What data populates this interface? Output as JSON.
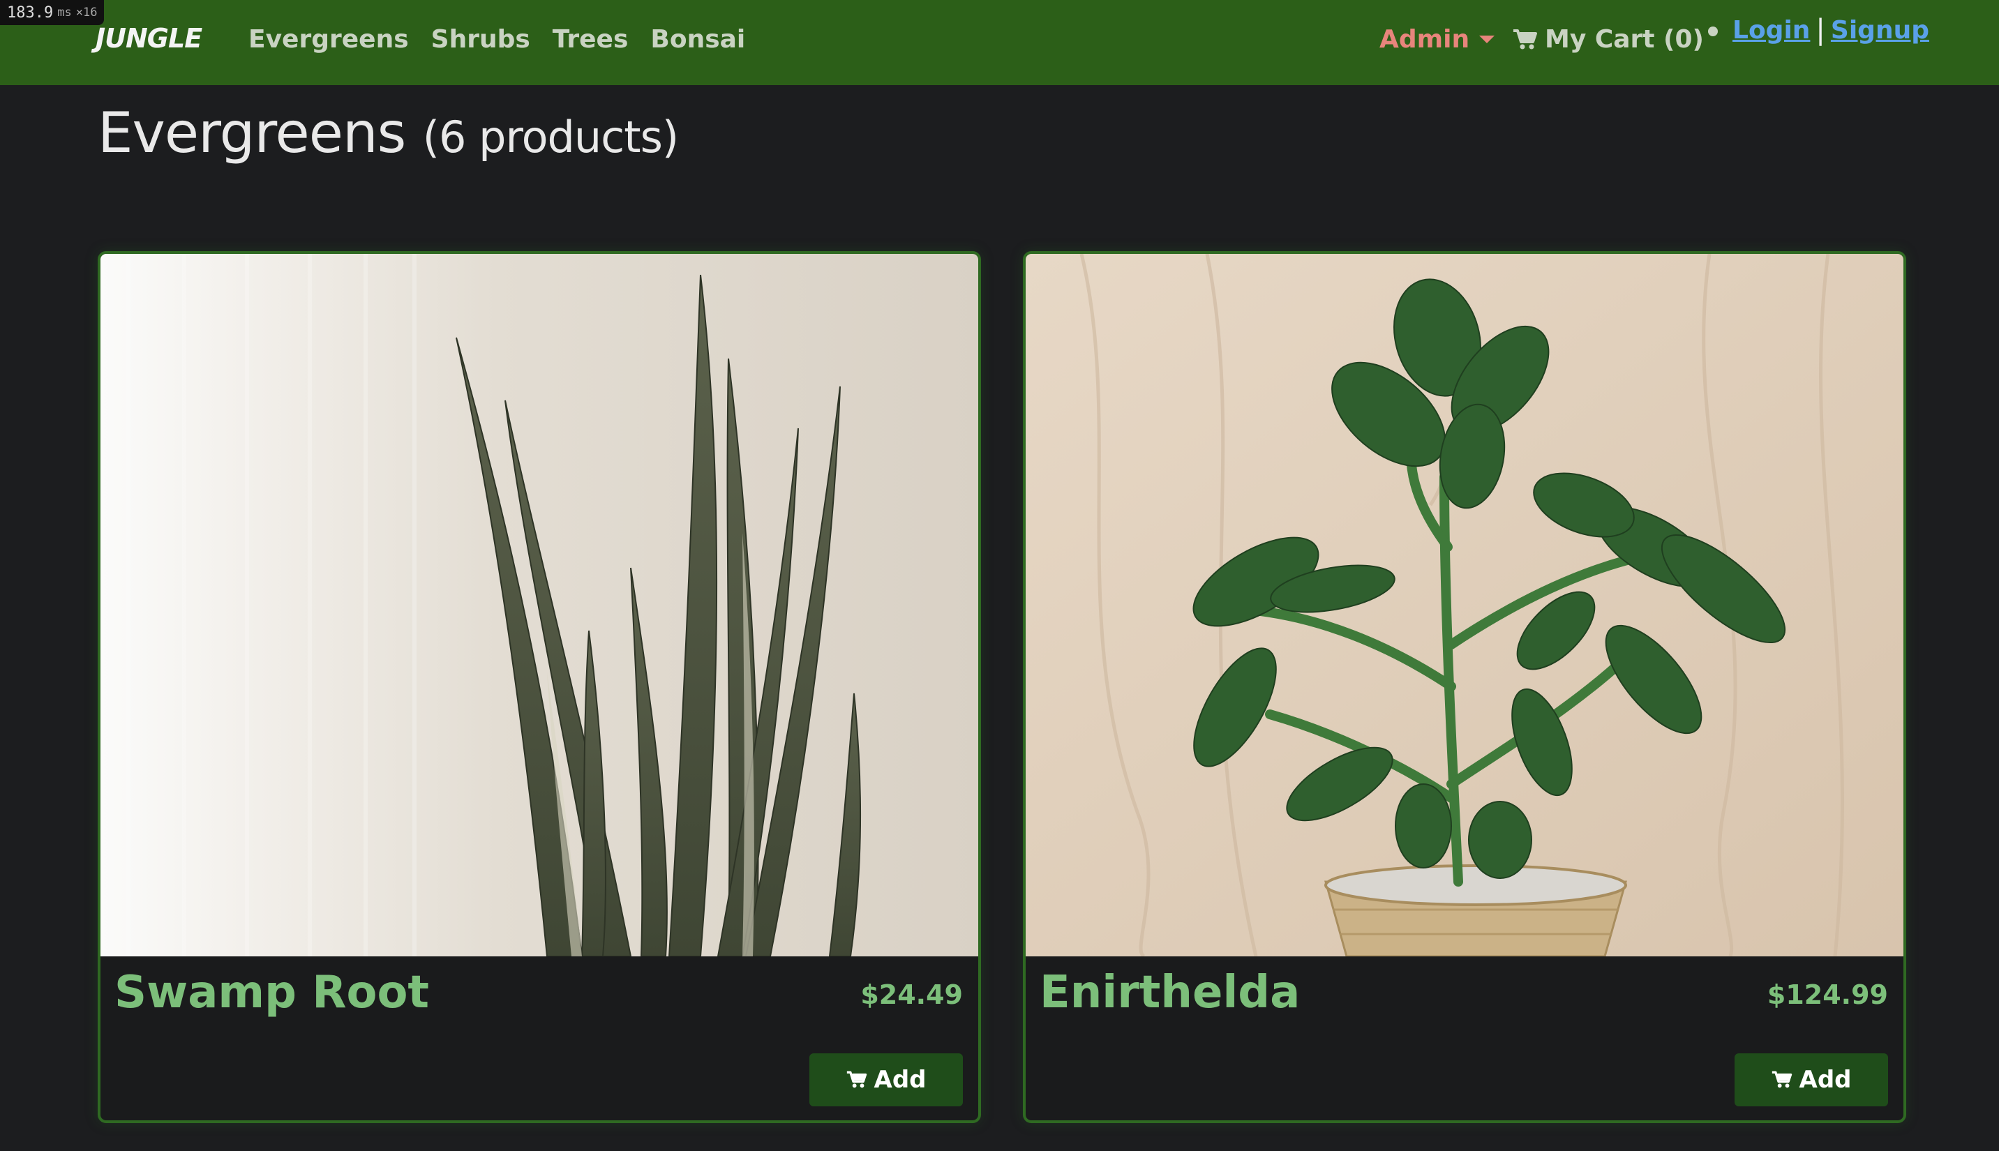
{
  "perf": {
    "value": "183.9",
    "unit": "ms",
    "multiplier": "×16"
  },
  "nav": {
    "brand": "JUNGLE",
    "links": [
      "Evergreens",
      "Shrubs",
      "Trees",
      "Bonsai"
    ],
    "admin_label": "Admin",
    "cart_label": "My Cart (0)",
    "login": "Login",
    "separator": "|",
    "signup": "Signup"
  },
  "page": {
    "title": "Evergreens",
    "count": "(6 products)"
  },
  "products": [
    {
      "name": "Swamp Root",
      "price": "$24.49",
      "button": "Add",
      "image": "snake-plant-photo"
    },
    {
      "name": "Enirthelda",
      "price": "$124.99",
      "button": "Add",
      "image": "leafy-plant-in-wicker-pot-photo"
    }
  ],
  "colors": {
    "navbar": "#2c5f18",
    "background": "#1c1d1f",
    "accent_green": "#7cbf7a",
    "admin": "#e8857c",
    "link_blue": "#5aa1e8",
    "button": "#1f4d1a"
  }
}
